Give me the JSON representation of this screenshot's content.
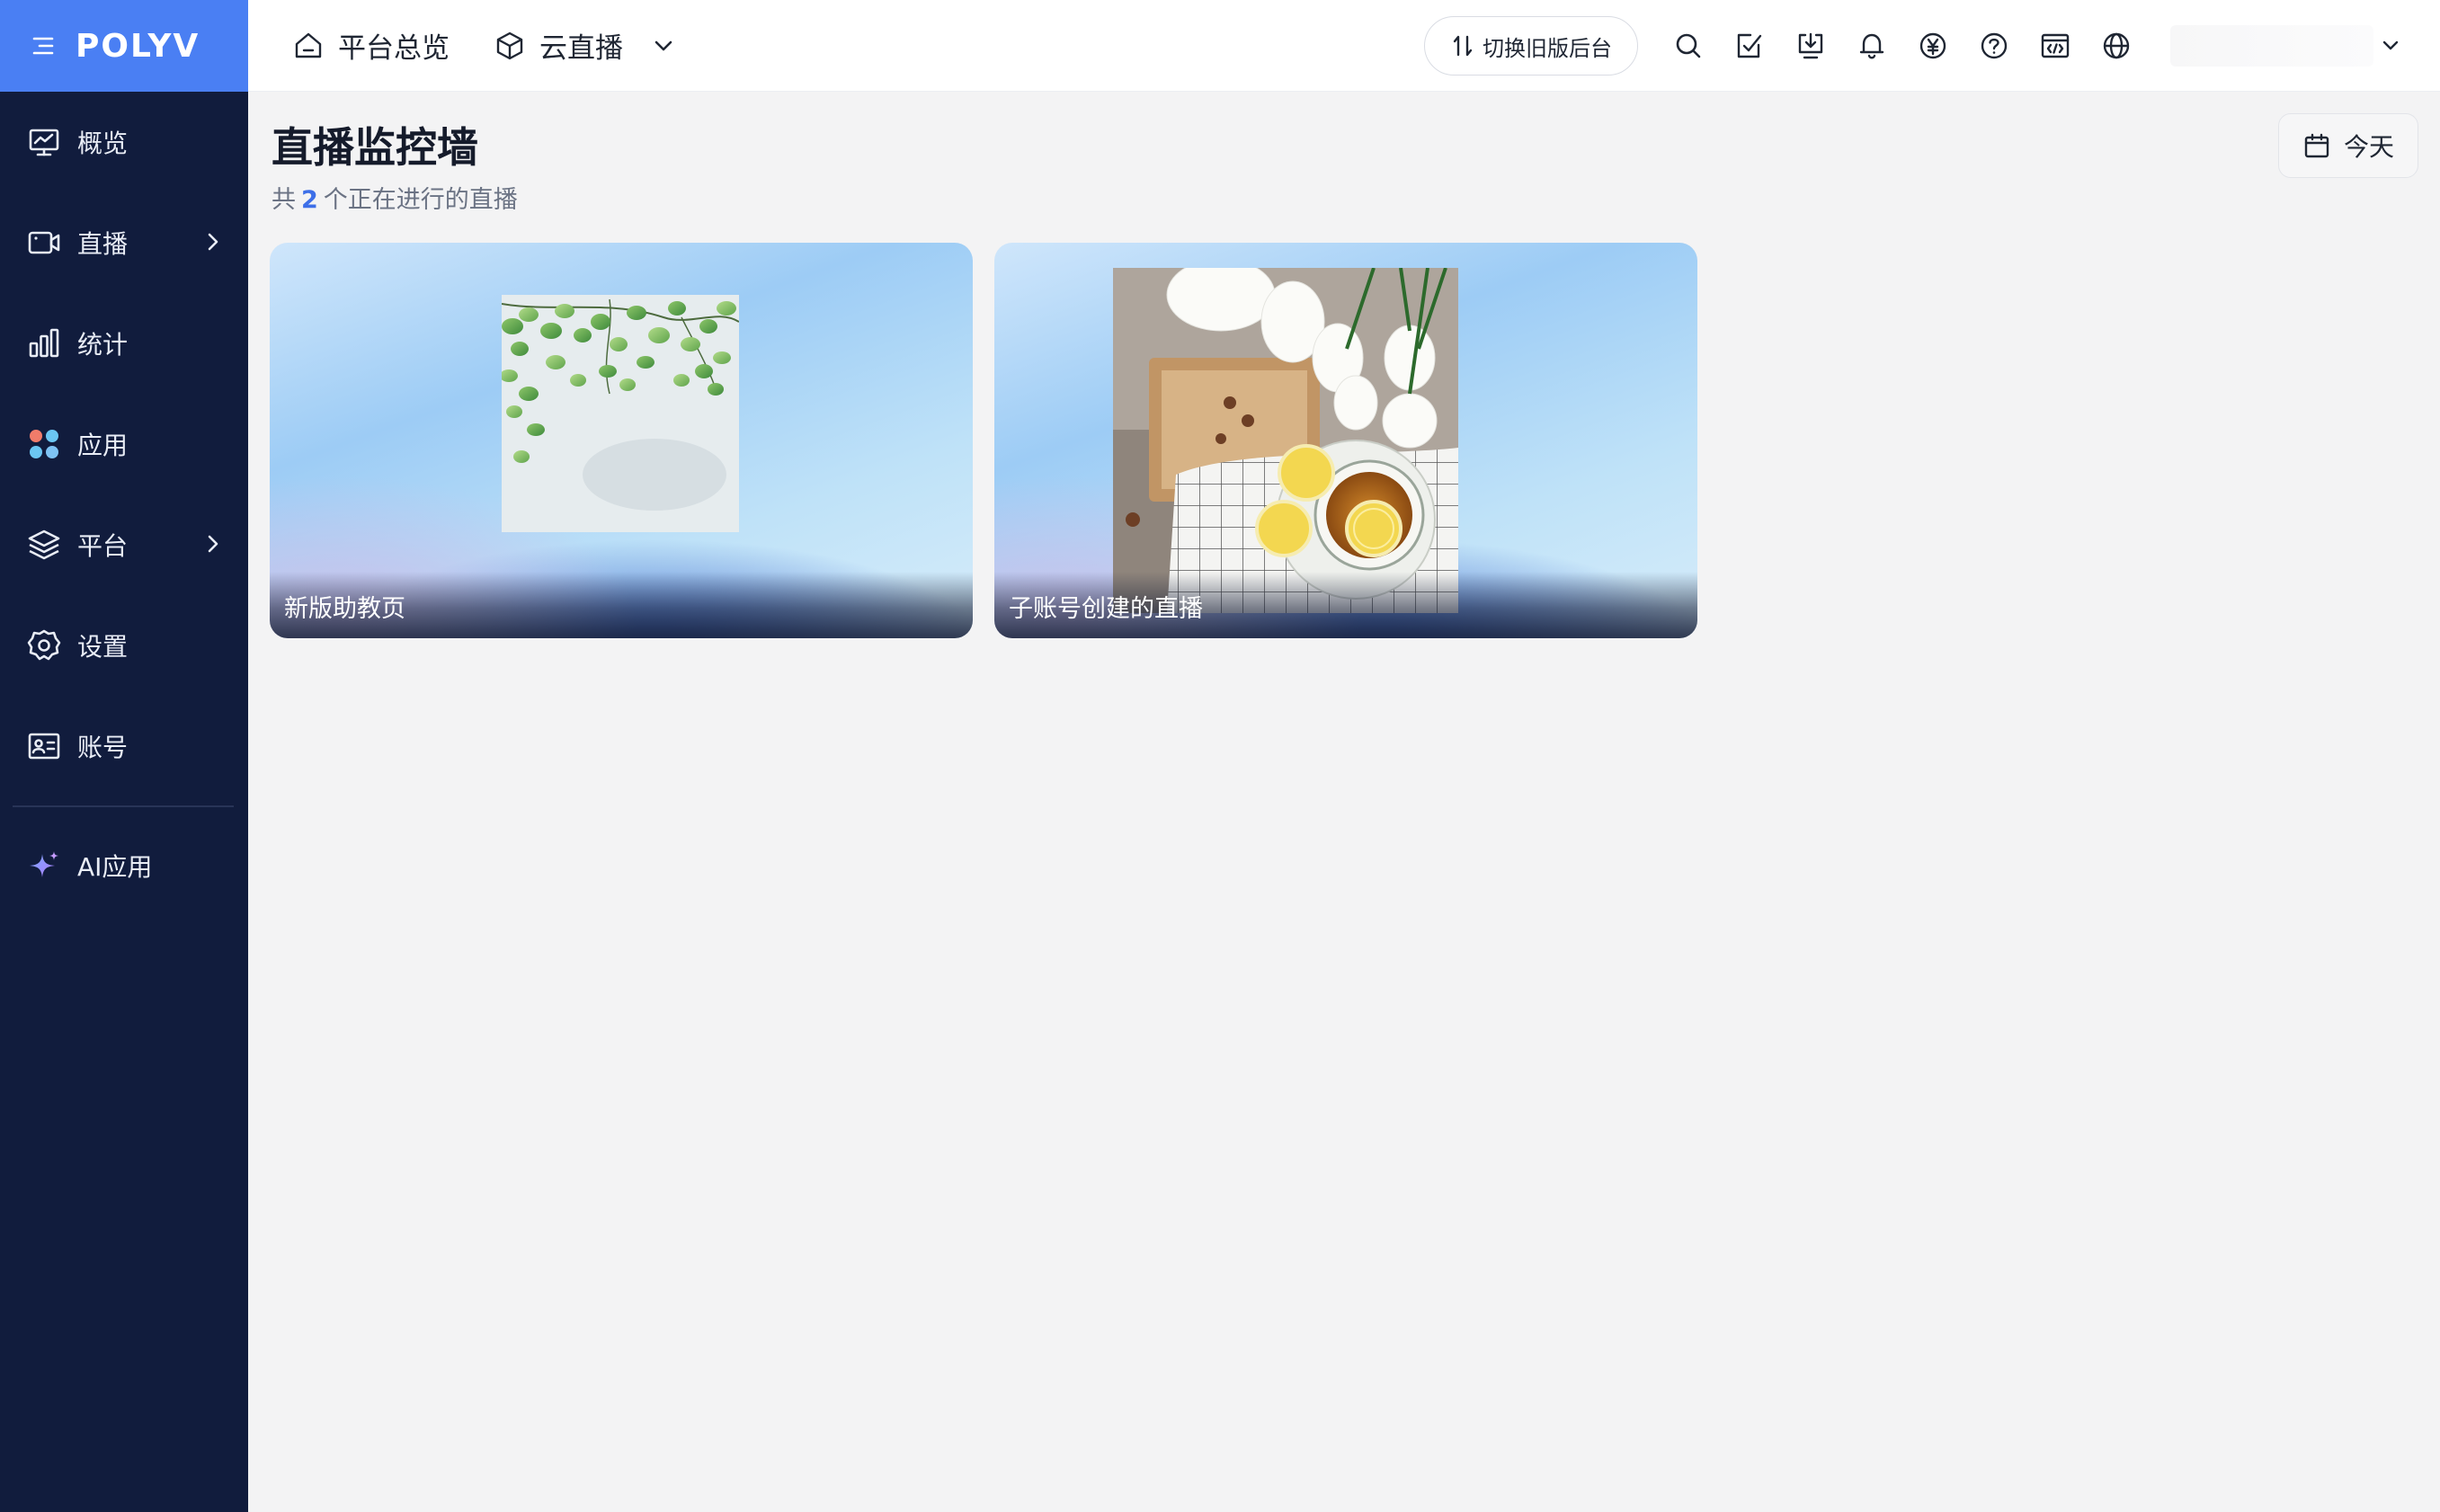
{
  "brand": {
    "logo": "POLYV"
  },
  "sidebar": {
    "items": [
      {
        "label": "概览",
        "icon": "monitor-chart-icon",
        "has_children": false
      },
      {
        "label": "直播",
        "icon": "video-camera-icon",
        "has_children": true
      },
      {
        "label": "统计",
        "icon": "bar-chart-icon",
        "has_children": false
      },
      {
        "label": "应用",
        "icon": "apps-icon",
        "has_children": false
      },
      {
        "label": "平台",
        "icon": "layers-icon",
        "has_children": true
      },
      {
        "label": "设置",
        "icon": "gear-icon",
        "has_children": false
      },
      {
        "label": "账号",
        "icon": "id-card-icon",
        "has_children": false
      }
    ],
    "ai_item": {
      "label": "AI应用",
      "icon": "sparkle-icon"
    }
  },
  "topbar": {
    "home_label": "平台总览",
    "product_label": "云直播",
    "switch_label": "切换旧版后台",
    "icons": [
      "search-icon",
      "task-check-icon",
      "download-icon",
      "bell-icon",
      "yen-icon",
      "help-icon",
      "code-window-icon",
      "globe-icon"
    ]
  },
  "page": {
    "title": "直播监控墙",
    "subtitle_prefix": "共",
    "count": "2",
    "subtitle_suffix": "个正在进行的直播",
    "date_label": "今天"
  },
  "cards": [
    {
      "title": "新版助教页",
      "thumbnail": "leaves"
    },
    {
      "title": "子账号创建的直播",
      "thumbnail": "tea-lemon-tulips"
    }
  ],
  "colors": {
    "sidebar_bg": "#111c3d",
    "brand_bg": "#4a7ff3",
    "accent": "#3d6fe8",
    "page_bg": "#f3f3f4"
  }
}
